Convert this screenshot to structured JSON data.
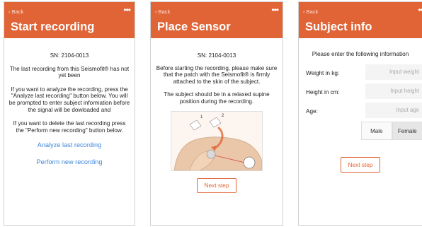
{
  "colors": {
    "accent": "#e06436",
    "link": "#3e86d9"
  },
  "common": {
    "back_label": "Back",
    "more_label": "•••"
  },
  "screen1": {
    "title": "Start recording",
    "sn": "SN: 2104-0013",
    "para1": "The last recording from this Seismofit® has not yet been",
    "para2": "If you want to analyze the recording, press the \"Analyze last recording\" button below. You will be prompted to enter subject information before the signal will be dowloaded and",
    "para3": "If you want to delete the last recording press the \"Perform new recording\" button below.",
    "analyze_link": "Analyze last recording",
    "perform_link": "Perform new recording"
  },
  "screen2": {
    "title": "Place Sensor",
    "sn": "SN: 2104-0013",
    "para1": "Before starting the recording, please make sure that the patch with the Seismofit® is firmly attached to the skin of the subject.",
    "para2": "The subject should be in a relaxed supine position during the recording.",
    "step1": "1",
    "step2": "2",
    "next_label": "Next step"
  },
  "screen3": {
    "title": "Subject info",
    "intro": "Please enter the following information",
    "weight_label": "Weight in kg:",
    "weight_placeholder": "Input weight",
    "height_label": "Height in cm:",
    "height_placeholder": "Input height",
    "age_label": "Age:",
    "age_placeholder": "Input age",
    "sex_options": [
      "Male",
      "Female"
    ],
    "sex_selected": "Female",
    "next_label": "Next step"
  }
}
